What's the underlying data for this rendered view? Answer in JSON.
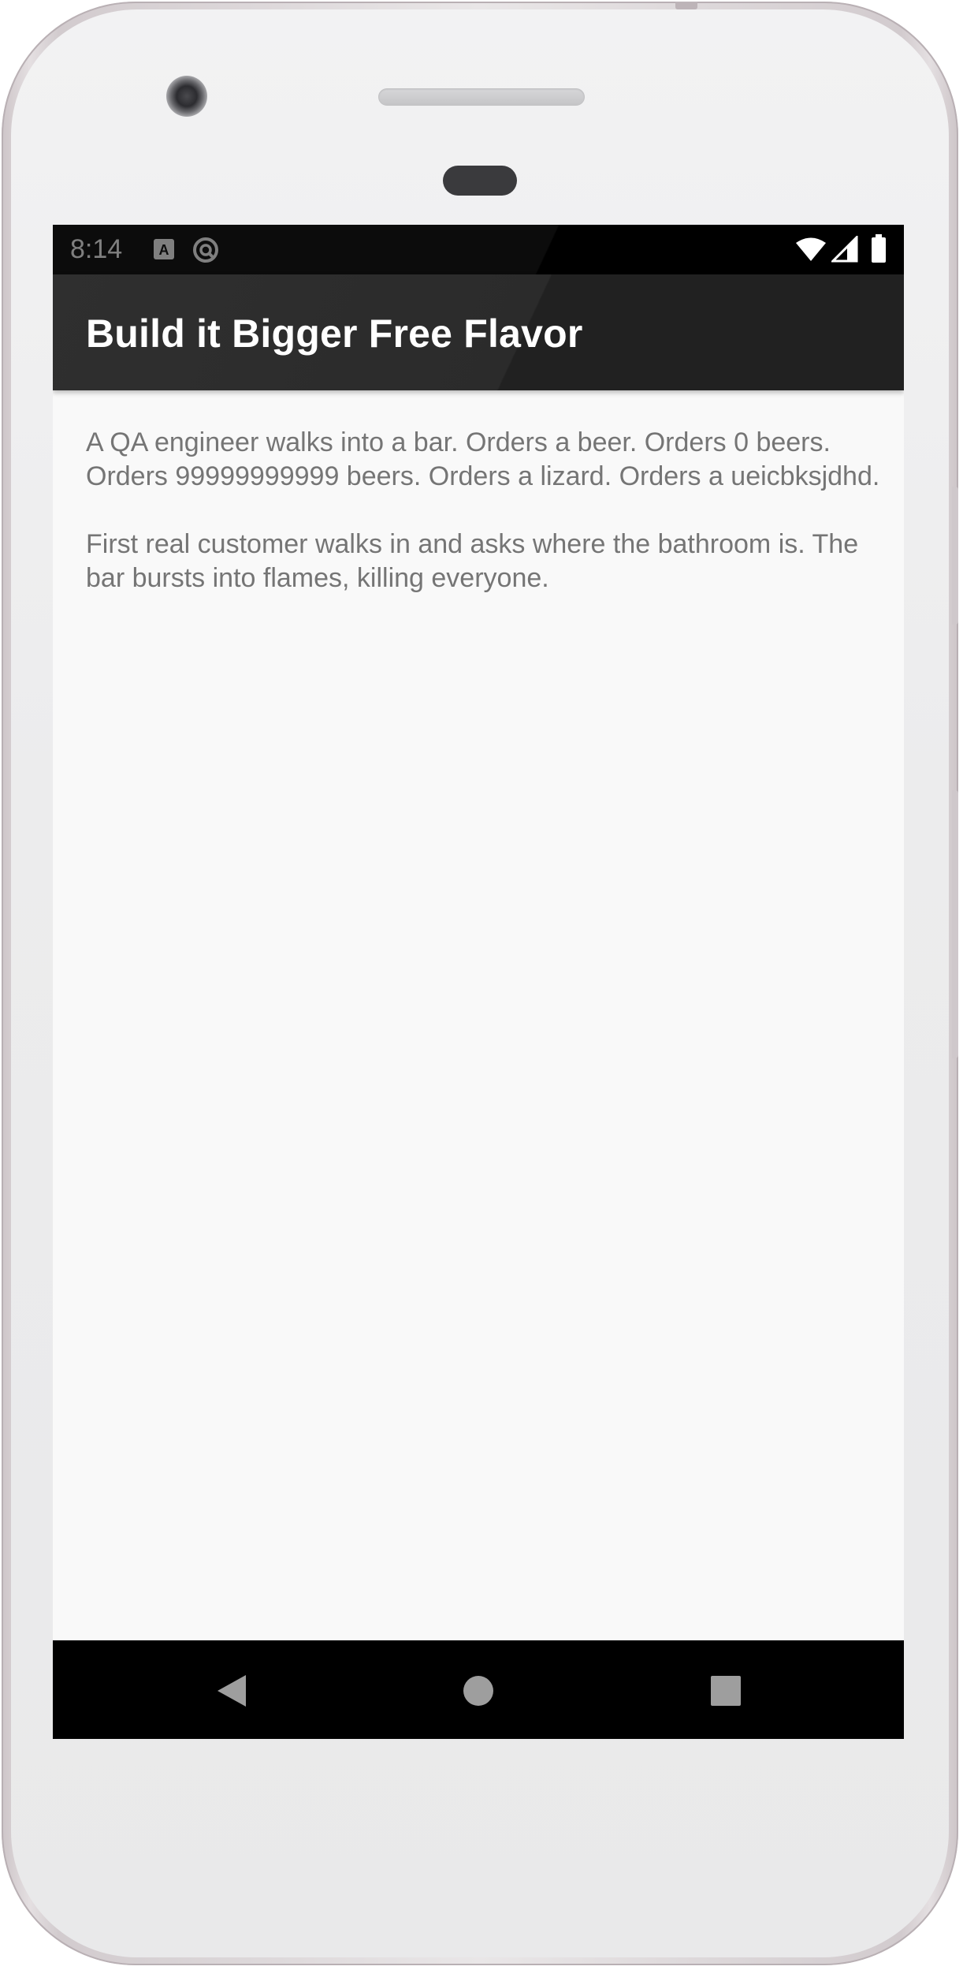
{
  "status_bar": {
    "time": "8:14",
    "notification_icons": [
      "font-a-icon",
      "sync-circle-icon"
    ],
    "system_icons": [
      "wifi-icon",
      "signal-icon",
      "battery-icon"
    ]
  },
  "app_bar": {
    "title": "Build it Bigger Free Flavor"
  },
  "content": {
    "joke": "A QA engineer walks into a bar. Orders a beer. Orders 0 beers. Orders 99999999999 beers. Orders a lizard. Orders a ueicbksjdhd.\n\nFirst real customer walks in and asks where the bathroom is. The bar bursts into flames, killing everyone."
  },
  "nav_bar": {
    "buttons": [
      "back-icon",
      "home-icon",
      "recents-icon"
    ]
  },
  "colors": {
    "app_bar": "#212121",
    "status_bar": "#000000",
    "background": "#f9f9f9",
    "body_text": "#757575"
  }
}
